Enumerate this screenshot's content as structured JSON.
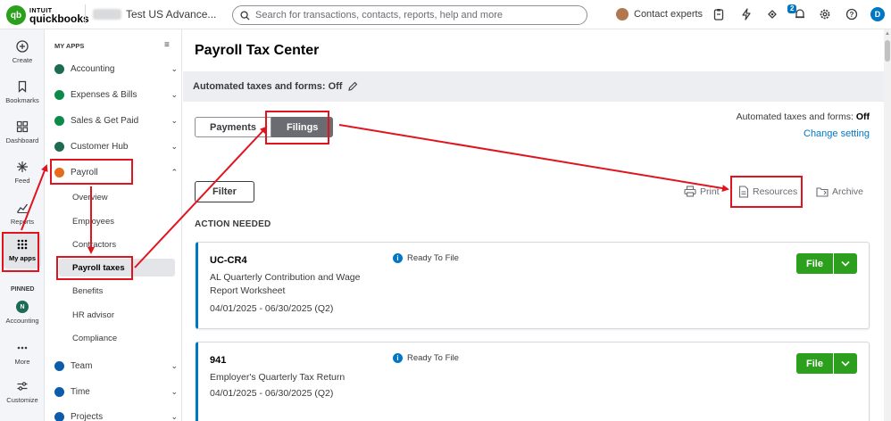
{
  "topbar": {
    "logo_mark": "qb",
    "logo_intuit": "INTUIT",
    "logo_name": "quickbooks",
    "company_name": "Test US Advance...",
    "search_placeholder": "Search for transactions, contacts, reports, help and more",
    "contact_label": "Contact experts",
    "notification_count": "2",
    "user_initial": "D"
  },
  "rail": {
    "items": [
      {
        "label": "Create",
        "icon": "plus-circle-icon"
      },
      {
        "label": "Bookmarks",
        "icon": "bookmark-icon"
      },
      {
        "label": "Dashboard",
        "icon": "dashboard-icon"
      },
      {
        "label": "Feed",
        "icon": "sparkle-icon"
      },
      {
        "label": "Reports",
        "icon": "chart-icon"
      },
      {
        "label": "My apps",
        "icon": "grid-icon"
      }
    ],
    "pinned_label": "PINNED",
    "pinned": [
      {
        "label": "Accounting",
        "icon_text": "N"
      },
      {
        "label": "More",
        "icon": "more-icon"
      },
      {
        "label": "Customize",
        "icon": "sliders-icon"
      }
    ]
  },
  "appmenu": {
    "title": "MY APPS",
    "apps": [
      {
        "label": "Accounting",
        "color": "#1d6b53",
        "chevron": "⌄"
      },
      {
        "label": "Expenses & Bills",
        "color": "#0d8a4a",
        "chevron": "⌄"
      },
      {
        "label": "Sales & Get Paid",
        "color": "#0d8a4a",
        "chevron": "⌄"
      },
      {
        "label": "Customer Hub",
        "color": "#1d6b53",
        "chevron": "⌄"
      },
      {
        "label": "Payroll",
        "color": "#e66b1c",
        "chevron": "⌃"
      }
    ],
    "payroll_sub": [
      {
        "label": "Overview"
      },
      {
        "label": "Employees"
      },
      {
        "label": "Contractors"
      },
      {
        "label": "Payroll taxes"
      },
      {
        "label": "Benefits"
      },
      {
        "label": "HR advisor"
      },
      {
        "label": "Compliance"
      }
    ],
    "apps_bottom": [
      {
        "label": "Team",
        "color": "#0b5cab",
        "chevron": "⌄"
      },
      {
        "label": "Time",
        "color": "#0b5cab",
        "chevron": "⌄"
      },
      {
        "label": "Projects",
        "color": "#0b5cab",
        "chevron": "⌄"
      }
    ]
  },
  "main": {
    "title": "Payroll Tax Center",
    "autobar_text": "Automated taxes and forms: Off",
    "tabs": [
      {
        "label": "Payments"
      },
      {
        "label": "Filings"
      }
    ],
    "auto_status_label": "Automated taxes and forms: ",
    "auto_status_value": "Off",
    "change_setting": "Change setting",
    "filter_label": "Filter",
    "print_label": "Print",
    "resources_label": "Resources",
    "archive_label": "Archive",
    "section_title": "ACTION NEEDED",
    "cards": [
      {
        "code": "UC-CR4",
        "description": "AL Quarterly Contribution and Wage Report Worksheet",
        "period": "04/01/2025 - 06/30/2025 (Q2)",
        "status": "Ready To File",
        "action": "File"
      },
      {
        "code": "941",
        "description": "Employer's Quarterly Tax Return",
        "period": "04/01/2025 - 06/30/2025 (Q2)",
        "status": "Ready To File",
        "action": "File"
      }
    ]
  },
  "colors": {
    "brand_green": "#2ca01c",
    "link_blue": "#0077c5",
    "annotation_red": "#e0141e"
  }
}
